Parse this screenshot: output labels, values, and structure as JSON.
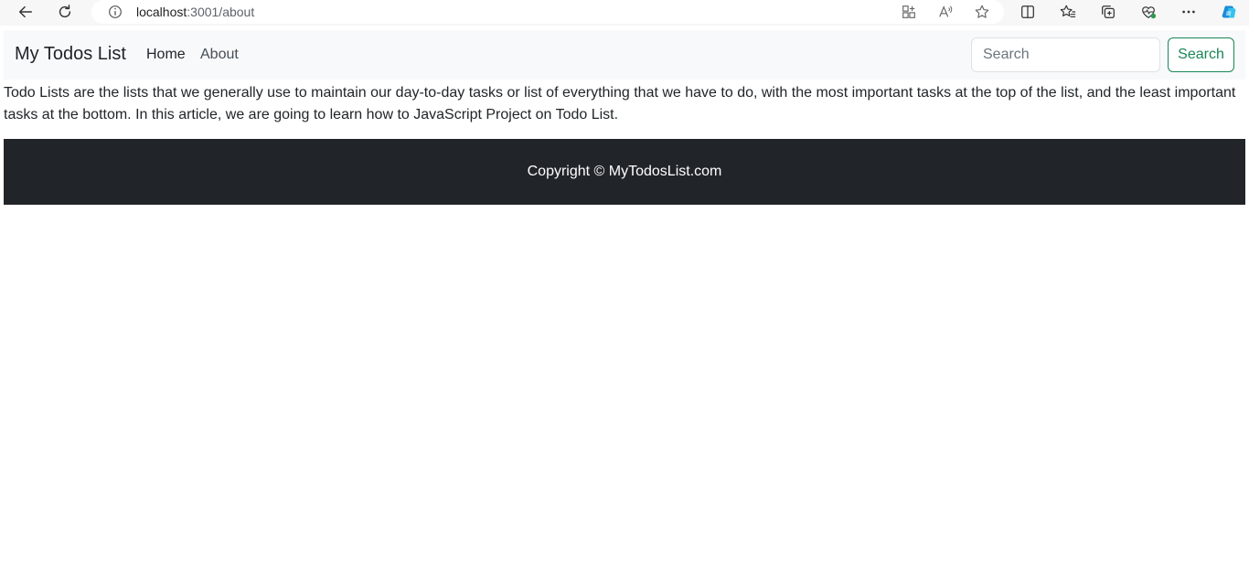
{
  "browser": {
    "url_host": "localhost",
    "url_path": ":3001/about"
  },
  "navbar": {
    "brand": "My Todos List",
    "links": [
      {
        "label": "Home"
      },
      {
        "label": "About"
      }
    ],
    "search": {
      "placeholder": "Search",
      "value": "",
      "button_label": "Search"
    }
  },
  "content": {
    "paragraph": "Todo Lists are the lists that we generally use to maintain our day-to-day tasks or list of everything that we have to do, with the most important tasks at the top of the list, and the least important tasks at the bottom. In this article, we are going to learn how to JavaScript Project on Todo List."
  },
  "footer": {
    "text": "Copyright © MyTodosList.com"
  },
  "colors": {
    "navbar_bg": "#f8f9fa",
    "footer_bg": "#212529",
    "accent_success": "#198754"
  },
  "icons": {
    "back": "arrow-left-icon",
    "reload": "reload-icon",
    "info": "info-icon",
    "apps": "apps-icon",
    "read_aloud": "read-aloud-icon",
    "favorite": "star-icon",
    "split_screen": "split-screen-icon",
    "favorites": "favorites-icon",
    "collections": "collections-icon",
    "performance": "performance-icon",
    "more": "more-icon",
    "copilot": "copilot-icon"
  }
}
